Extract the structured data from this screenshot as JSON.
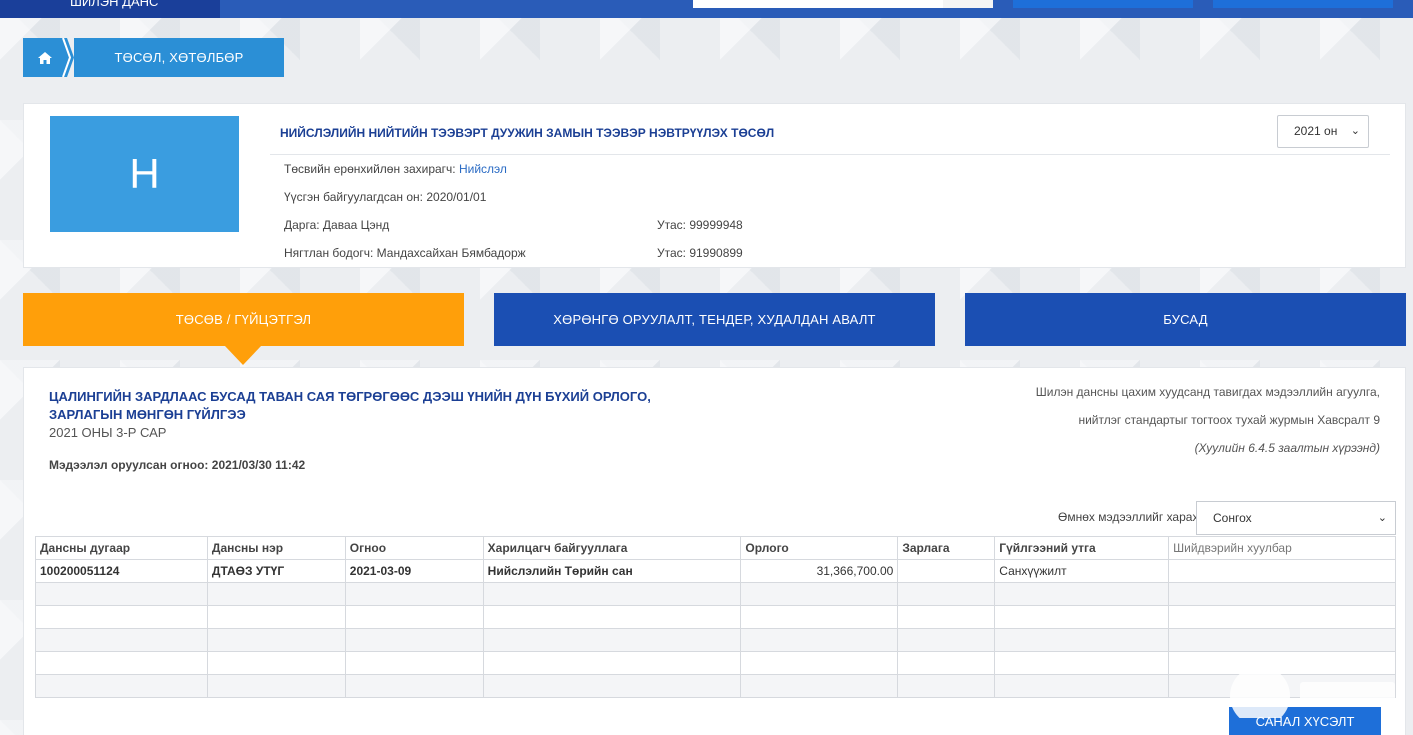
{
  "topbar": {
    "brand": "ШИЛЭН ДАНС"
  },
  "breadcrumb": {
    "current": "ТӨСӨЛ, ХӨТӨЛБӨР"
  },
  "org": {
    "logo_letter": "Н",
    "title": "НИЙСЛЭЛИЙН НИЙТИЙН ТЭЭВЭРТ ДУУЖИН ЗАМЫН ТЭЭВЭР НЭВТРҮҮЛЭХ ТӨСӨЛ",
    "year": "2021 он",
    "budget_manager_label": "Төсвийн ерөнхийлөн захирагч:",
    "budget_manager_value": "Нийслэл",
    "founded": "Үүсгэн байгуулагдсан он: 2020/01/01",
    "director": "Дарга: Даваа Цэнд",
    "director_phone": "Утас: 99999948",
    "accountant": "Нягтлан бодогч: Мандахсайхан Бямбадорж",
    "accountant_phone": "Утас: 91990899"
  },
  "tabs": [
    {
      "label": "ТӨСӨВ / ГҮЙЦЭТГЭЛ"
    },
    {
      "label": "ХӨРӨНГӨ ОРУУЛАЛТ, ТЕНДЕР, ХУДАЛДАН АВАЛТ"
    },
    {
      "label": "БУСАД"
    }
  ],
  "panel": {
    "title": "ЦАЛИНГИЙН ЗАРДЛААС БУСАД ТАВАН САЯ ТӨГРӨГӨӨС ДЭЭШ ҮНИЙН ДҮН БҮХИЙ ОРЛОГО, ЗАРЛАГЫН МӨНГӨН ГҮЙЛГЭЭ",
    "subtitle": "2021 ОНЫ 3-Р САР",
    "date_label": "Мэдээлэл оруулсан огноо:",
    "date_value": "2021/03/30 11:42",
    "note_line1": "Шилэн дансны цахим хуудсанд тавигдах мэдээллийн агуулга,",
    "note_line2": "нийтлэг стандартыг тогтоох тухай журмын Хавсралт 9",
    "note_line3": "(Хуулийн 6.4.5 заалтын хүрээнд)",
    "prev_label": "Өмнөх мэдээллийг харах",
    "prev_select": "Сонгох"
  },
  "table": {
    "headers": [
      "Дансны дугаар",
      "Дансны нэр",
      "Огноо",
      "Харилцагч байгууллага",
      "Орлого",
      "Зарлага",
      "Гүйлгээний утга",
      "Шийдвэрийн хуулбар"
    ],
    "row": {
      "account_no": "100200051124",
      "account_name": "ДТАӨЗ УТҮГ",
      "date": "2021-03-09",
      "counterparty": "Нийслэлийн Төрийн сан",
      "income": "31,366,700.00",
      "expense": "",
      "description": "Санхүүжилт",
      "decision": ""
    }
  },
  "submit_label": "САНАЛ ХҮСЭЛТ ИЛГЭЭХ",
  "colors": {
    "primary": "#1b4fb3",
    "accent": "#ff9f0a",
    "light_blue": "#2b8fd6"
  }
}
